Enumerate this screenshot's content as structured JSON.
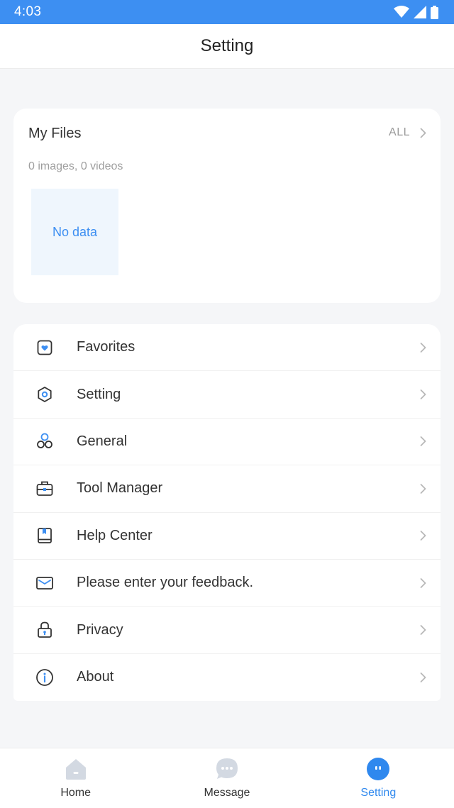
{
  "status_bar": {
    "time": "4:03"
  },
  "app_bar": {
    "title": "Setting"
  },
  "my_files": {
    "title": "My Files",
    "all_label": "ALL",
    "counts": "0 images, 0 videos",
    "empty_text": "No data"
  },
  "menu": {
    "items": [
      {
        "label": "Favorites",
        "icon": "favorites-icon"
      },
      {
        "label": "Setting",
        "icon": "settings-hex-icon"
      },
      {
        "label": "General",
        "icon": "general-icon"
      },
      {
        "label": "Tool Manager",
        "icon": "toolbox-icon"
      },
      {
        "label": "Help Center",
        "icon": "book-icon"
      },
      {
        "label": "Please enter your feedback.",
        "icon": "mail-icon"
      },
      {
        "label": "Privacy",
        "icon": "lock-icon"
      },
      {
        "label": "About",
        "icon": "info-icon"
      }
    ]
  },
  "tabbar": {
    "tabs": [
      {
        "label": "Home",
        "icon": "home-icon",
        "active": false
      },
      {
        "label": "Message",
        "icon": "message-icon",
        "active": false
      },
      {
        "label": "Setting",
        "icon": "setting-tab-icon",
        "active": true
      }
    ]
  },
  "colors": {
    "accent": "#3d8ff2",
    "status_bar": "#3d8ff2",
    "inactive_icon": "#d3d9e2",
    "background": "#f5f6f8"
  }
}
